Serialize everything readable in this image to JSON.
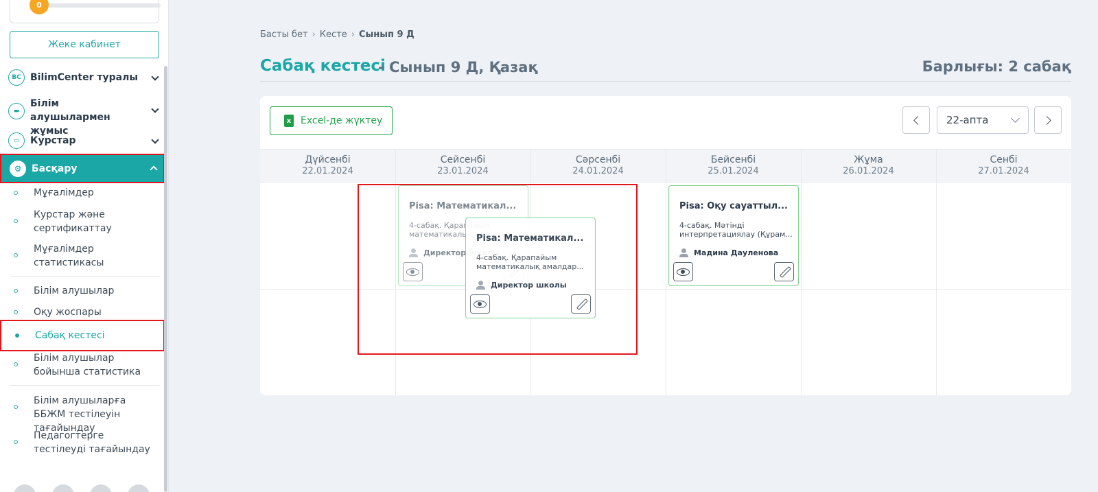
{
  "sidebar": {
    "level_value": "0",
    "cabinet_label": "Жеке кабинет",
    "menu": [
      {
        "label": "BilimCenter туралы",
        "icon": "BC"
      },
      {
        "label": "Білім алушылармен жұмыс",
        "icon": "briefcase"
      },
      {
        "label": "Курстар",
        "icon": "monitor"
      },
      {
        "label": "Басқару",
        "icon": "gear"
      }
    ],
    "sub_items": [
      "Мұғалімдер",
      "Курстар және сертификаттау",
      "Мұғалімдер статистикасы",
      "Білім алушылар",
      "Оқу жоспары",
      "Сабақ кестесі",
      "Білім алушылар бойынша статистика",
      "Білім алушыларға ББЖМ тестілеуін тағайындау",
      "Педагогтерге тестілеуді тағайындау"
    ]
  },
  "breadcrumb": {
    "home": "Басты бет",
    "schedule": "Кесте",
    "current": "Сынып 9 Д",
    "sep": "›"
  },
  "header": {
    "title": "Сабақ кестесі",
    "subtitle": "- Сынып 9 Д, Қазақ",
    "total": "Барлығы: 2 сабақ"
  },
  "toolbar": {
    "excel_label": "Excel-де жүктеу",
    "week_value": "22-апта"
  },
  "days": [
    {
      "name": "Дүйсенбі",
      "date": "22.01.2024"
    },
    {
      "name": "Сейсенбі",
      "date": "23.01.2024"
    },
    {
      "name": "Сәрсенбі",
      "date": "24.01.2024"
    },
    {
      "name": "Бейсенбі",
      "date": "25.01.2024"
    },
    {
      "name": "Жұма",
      "date": "26.01.2024"
    },
    {
      "name": "Сенбі",
      "date": "27.01.2024"
    }
  ],
  "lessons": [
    {
      "title": "Pisa: Математикал...",
      "desc": "4-сабақ. Қарапайым математикалық амалдар...",
      "teacher": "Директор школы"
    },
    {
      "title": "Pisa: Математикал...",
      "desc": "4-сабақ. Қарапайым математикалық амалдар...",
      "teacher": "Директор школы"
    },
    {
      "title": "Pisa: Оқу сауаттыл...",
      "desc": "4-сабақ. Мәтінді интерпретациялау (Құрам...",
      "teacher": "Мадина Дауленова"
    }
  ],
  "colors": {
    "accent": "#1aa7a6",
    "highlight": "#e3171b",
    "excel": "#22a24b",
    "card_border": "#7fcf8f"
  }
}
